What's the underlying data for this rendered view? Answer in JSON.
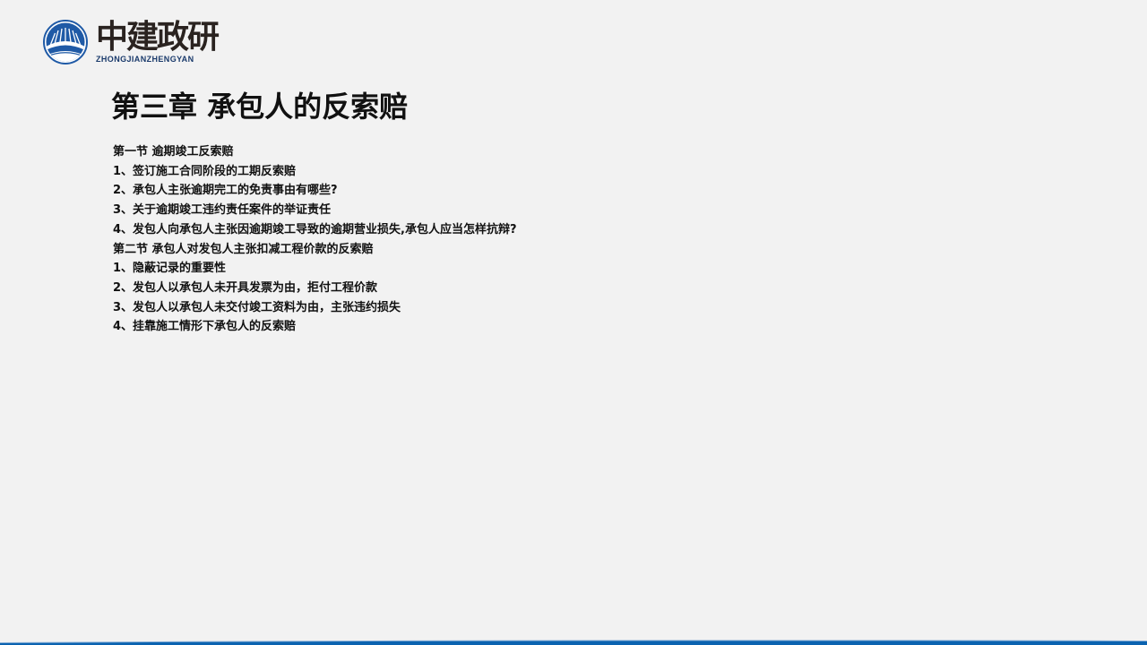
{
  "brand": {
    "name_cn": "中建政研",
    "name_en": "ZHONGJIANZHENGYAN",
    "primary_color": "#1f5aa6",
    "accent_color": "#0b63b0"
  },
  "slide": {
    "title": "第三章 承包人的反索赔",
    "toc": [
      "第一节 逾期竣工反索赔",
      "1、签订施工合同阶段的工期反索赔",
      "2、承包人主张逾期完工的免责事由有哪些?",
      "3、关于逾期竣工违约责任案件的举证责任",
      "4、发包人向承包人主张因逾期竣工导致的逾期营业损失,承包人应当怎样抗辩?",
      "第二节 承包人对发包人主张扣减工程价款的反索赔",
      "1、隐蔽记录的重要性",
      "2、发包人以承包人未开具发票为由，拒付工程价款",
      "3、发包人以承包人未交付竣工资料为由，主张违约损失",
      "4、挂靠施工情形下承包人的反索赔"
    ]
  }
}
